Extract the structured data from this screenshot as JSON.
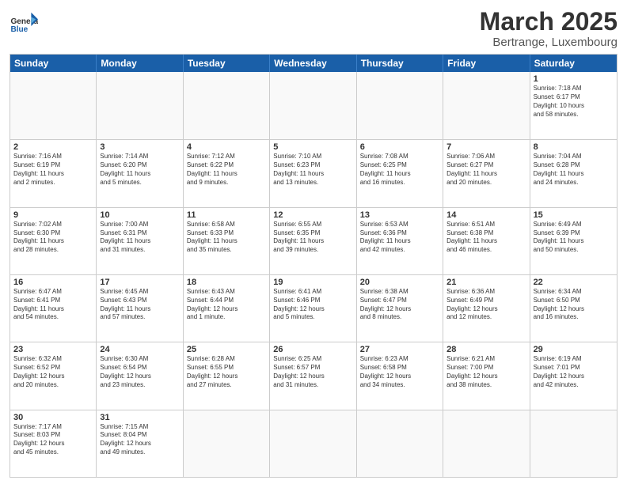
{
  "header": {
    "logo_general": "General",
    "logo_blue": "Blue",
    "title": "March 2025",
    "subtitle": "Bertrange, Luxembourg"
  },
  "days_of_week": [
    "Sunday",
    "Monday",
    "Tuesday",
    "Wednesday",
    "Thursday",
    "Friday",
    "Saturday"
  ],
  "weeks": [
    [
      {
        "day": "",
        "info": ""
      },
      {
        "day": "",
        "info": ""
      },
      {
        "day": "",
        "info": ""
      },
      {
        "day": "",
        "info": ""
      },
      {
        "day": "",
        "info": ""
      },
      {
        "day": "",
        "info": ""
      },
      {
        "day": "1",
        "info": "Sunrise: 7:18 AM\nSunset: 6:17 PM\nDaylight: 10 hours\nand 58 minutes."
      }
    ],
    [
      {
        "day": "2",
        "info": "Sunrise: 7:16 AM\nSunset: 6:19 PM\nDaylight: 11 hours\nand 2 minutes."
      },
      {
        "day": "3",
        "info": "Sunrise: 7:14 AM\nSunset: 6:20 PM\nDaylight: 11 hours\nand 5 minutes."
      },
      {
        "day": "4",
        "info": "Sunrise: 7:12 AM\nSunset: 6:22 PM\nDaylight: 11 hours\nand 9 minutes."
      },
      {
        "day": "5",
        "info": "Sunrise: 7:10 AM\nSunset: 6:23 PM\nDaylight: 11 hours\nand 13 minutes."
      },
      {
        "day": "6",
        "info": "Sunrise: 7:08 AM\nSunset: 6:25 PM\nDaylight: 11 hours\nand 16 minutes."
      },
      {
        "day": "7",
        "info": "Sunrise: 7:06 AM\nSunset: 6:27 PM\nDaylight: 11 hours\nand 20 minutes."
      },
      {
        "day": "8",
        "info": "Sunrise: 7:04 AM\nSunset: 6:28 PM\nDaylight: 11 hours\nand 24 minutes."
      }
    ],
    [
      {
        "day": "9",
        "info": "Sunrise: 7:02 AM\nSunset: 6:30 PM\nDaylight: 11 hours\nand 28 minutes."
      },
      {
        "day": "10",
        "info": "Sunrise: 7:00 AM\nSunset: 6:31 PM\nDaylight: 11 hours\nand 31 minutes."
      },
      {
        "day": "11",
        "info": "Sunrise: 6:58 AM\nSunset: 6:33 PM\nDaylight: 11 hours\nand 35 minutes."
      },
      {
        "day": "12",
        "info": "Sunrise: 6:55 AM\nSunset: 6:35 PM\nDaylight: 11 hours\nand 39 minutes."
      },
      {
        "day": "13",
        "info": "Sunrise: 6:53 AM\nSunset: 6:36 PM\nDaylight: 11 hours\nand 42 minutes."
      },
      {
        "day": "14",
        "info": "Sunrise: 6:51 AM\nSunset: 6:38 PM\nDaylight: 11 hours\nand 46 minutes."
      },
      {
        "day": "15",
        "info": "Sunrise: 6:49 AM\nSunset: 6:39 PM\nDaylight: 11 hours\nand 50 minutes."
      }
    ],
    [
      {
        "day": "16",
        "info": "Sunrise: 6:47 AM\nSunset: 6:41 PM\nDaylight: 11 hours\nand 54 minutes."
      },
      {
        "day": "17",
        "info": "Sunrise: 6:45 AM\nSunset: 6:43 PM\nDaylight: 11 hours\nand 57 minutes."
      },
      {
        "day": "18",
        "info": "Sunrise: 6:43 AM\nSunset: 6:44 PM\nDaylight: 12 hours\nand 1 minute."
      },
      {
        "day": "19",
        "info": "Sunrise: 6:41 AM\nSunset: 6:46 PM\nDaylight: 12 hours\nand 5 minutes."
      },
      {
        "day": "20",
        "info": "Sunrise: 6:38 AM\nSunset: 6:47 PM\nDaylight: 12 hours\nand 8 minutes."
      },
      {
        "day": "21",
        "info": "Sunrise: 6:36 AM\nSunset: 6:49 PM\nDaylight: 12 hours\nand 12 minutes."
      },
      {
        "day": "22",
        "info": "Sunrise: 6:34 AM\nSunset: 6:50 PM\nDaylight: 12 hours\nand 16 minutes."
      }
    ],
    [
      {
        "day": "23",
        "info": "Sunrise: 6:32 AM\nSunset: 6:52 PM\nDaylight: 12 hours\nand 20 minutes."
      },
      {
        "day": "24",
        "info": "Sunrise: 6:30 AM\nSunset: 6:54 PM\nDaylight: 12 hours\nand 23 minutes."
      },
      {
        "day": "25",
        "info": "Sunrise: 6:28 AM\nSunset: 6:55 PM\nDaylight: 12 hours\nand 27 minutes."
      },
      {
        "day": "26",
        "info": "Sunrise: 6:25 AM\nSunset: 6:57 PM\nDaylight: 12 hours\nand 31 minutes."
      },
      {
        "day": "27",
        "info": "Sunrise: 6:23 AM\nSunset: 6:58 PM\nDaylight: 12 hours\nand 34 minutes."
      },
      {
        "day": "28",
        "info": "Sunrise: 6:21 AM\nSunset: 7:00 PM\nDaylight: 12 hours\nand 38 minutes."
      },
      {
        "day": "29",
        "info": "Sunrise: 6:19 AM\nSunset: 7:01 PM\nDaylight: 12 hours\nand 42 minutes."
      }
    ],
    [
      {
        "day": "30",
        "info": "Sunrise: 7:17 AM\nSunset: 8:03 PM\nDaylight: 12 hours\nand 45 minutes."
      },
      {
        "day": "31",
        "info": "Sunrise: 7:15 AM\nSunset: 8:04 PM\nDaylight: 12 hours\nand 49 minutes."
      },
      {
        "day": "",
        "info": ""
      },
      {
        "day": "",
        "info": ""
      },
      {
        "day": "",
        "info": ""
      },
      {
        "day": "",
        "info": ""
      },
      {
        "day": "",
        "info": ""
      }
    ]
  ]
}
